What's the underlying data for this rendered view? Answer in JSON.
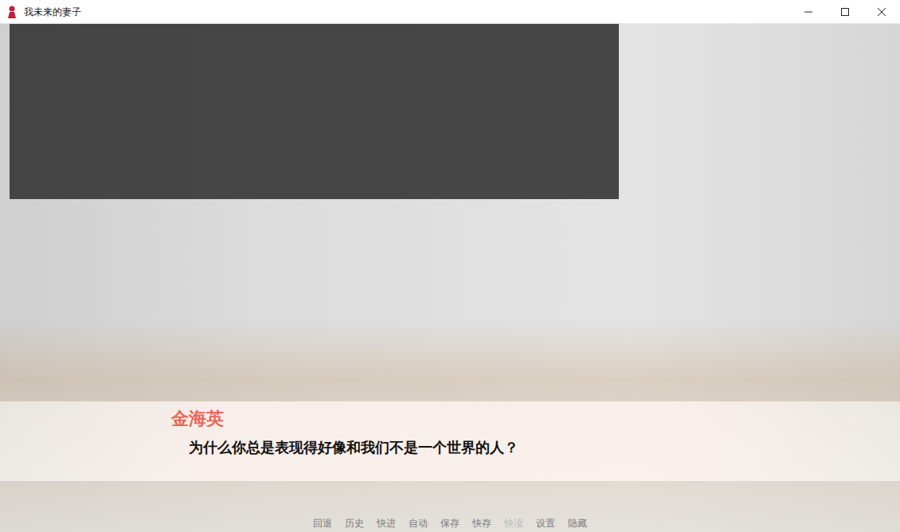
{
  "window": {
    "title": "我未来的妻子"
  },
  "dialogue": {
    "speaker": "金海英",
    "text": "为什么你总是表现得好像和我们不是一个世界的人？"
  },
  "quick_menu": [
    {
      "label": "回退",
      "disabled": false
    },
    {
      "label": "历史",
      "disabled": false
    },
    {
      "label": "快进",
      "disabled": false
    },
    {
      "label": "自动",
      "disabled": false
    },
    {
      "label": "保存",
      "disabled": false
    },
    {
      "label": "快存",
      "disabled": false
    },
    {
      "label": "快读",
      "disabled": true
    },
    {
      "label": "设置",
      "disabled": false
    },
    {
      "label": "隐藏",
      "disabled": false
    }
  ]
}
